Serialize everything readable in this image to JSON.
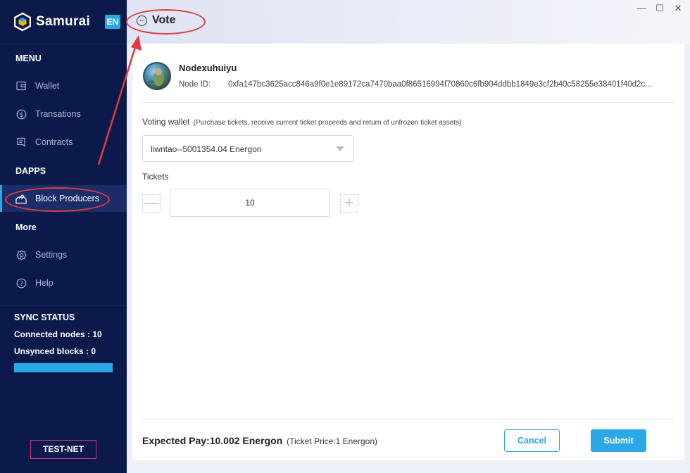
{
  "app": {
    "name": "Samurai",
    "language": "EN"
  },
  "window_controls": {
    "minimize": "—",
    "maximize": "☐",
    "close": "✕"
  },
  "sidebar": {
    "menu_title": "MENU",
    "menu_items": [
      {
        "label": "Wallet",
        "icon": "wallet-icon"
      },
      {
        "label": "Transations",
        "icon": "dollar-circle-icon"
      },
      {
        "label": "Contracts",
        "icon": "contract-icon"
      }
    ],
    "dapps_title": "DAPPS",
    "dapps_items": [
      {
        "label": "Block Producers",
        "icon": "vote-box-icon",
        "active": true
      }
    ],
    "more_title": "More",
    "more_items": [
      {
        "label": "Settings",
        "icon": "gear-icon"
      },
      {
        "label": "Help",
        "icon": "help-icon"
      }
    ],
    "sync": {
      "title": "SYNC STATUS",
      "connected_nodes": "Connected nodes : 10",
      "unsynced_blocks": "Unsynced blocks : 0",
      "progress": 1.0
    },
    "network": "TEST-NET"
  },
  "header": {
    "back_icon": "arrow-left-circle-icon",
    "title": "Vote"
  },
  "node": {
    "name": "Nodexuhuiyu",
    "id_label": "Node ID:",
    "id_value": "0xfa147bc3625acc846a9f0e1e89172ca7470baa0f86516994f70860c6fb904ddbb1849e3cf2b40c58255e38401f40d2c..."
  },
  "form": {
    "voting_wallet_label": "Voting wallet",
    "voting_wallet_hint": "(Purchase tickets, receive current ticket proceeds and return of unfrozen ticket assets)",
    "voting_wallet_value": "liwntao--5001354.04 Energon",
    "tickets_label": "Tickets",
    "tickets_value": "10",
    "minus": "—",
    "plus": "+"
  },
  "footer": {
    "expected_pay": "Expected Pay:10.002 Energon",
    "ticket_price": "(Ticket Price:1 Energon)",
    "cancel_label": "Cancel",
    "submit_label": "Submit"
  },
  "colors": {
    "sidebar_bg": "#0c1a4b",
    "accent": "#2aa7e6",
    "testnet_border": "#d6337a",
    "annotation": "#e23b3b"
  }
}
